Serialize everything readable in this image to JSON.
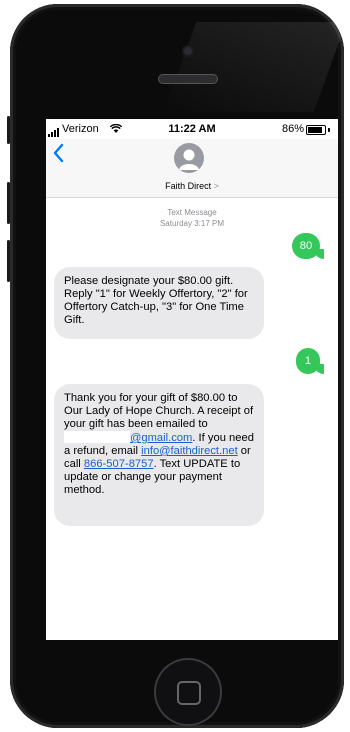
{
  "status_bar": {
    "carrier": "Verizon",
    "time": "11:22 AM",
    "battery_percent": "86%",
    "battery_level": 0.86
  },
  "header": {
    "back_icon": "chevron-left-icon",
    "avatar_icon": "person-icon",
    "contact_name": "Faith Direct",
    "chevron": ">"
  },
  "meta": {
    "label": "Text Message",
    "timestamp": "Saturday 3:17 PM"
  },
  "messages": [
    {
      "direction": "sent",
      "text": "80"
    },
    {
      "direction": "received",
      "text": "Please designate your $80.00 gift. Reply \"1\" for Weekly Offertory, \"2\" for Offertory Catch-up, \"3\" for One Time Gift."
    },
    {
      "direction": "sent",
      "text": "1"
    },
    {
      "direction": "received",
      "line1": "Thank you for your gift of $80.00 to Our Lady of Hope Church. A receipt of your gift has been emailed to",
      "email_domain": "@gmail.com",
      "line2": ". If you need a refund, email",
      "email_support": "info@faithdirect.net",
      "line3": " or call",
      "phone": "866-507-8757",
      "line4": ". Text UPDATE to update or change your payment method."
    }
  ],
  "colors": {
    "sent_bubble": "#34c759",
    "received_bubble": "#e9e9eb",
    "link": "#1a5fd0",
    "back_chevron": "#007aff"
  }
}
